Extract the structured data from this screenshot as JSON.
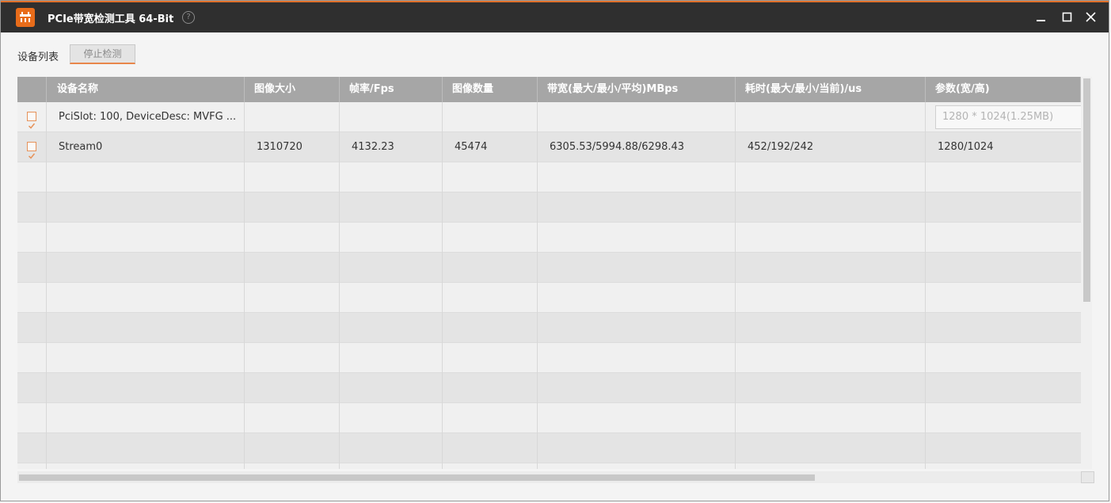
{
  "window": {
    "title": "PCIe带宽检测工具 64-Bit",
    "help_symbol": "?",
    "accent_color": "#e86c1a"
  },
  "toolbar": {
    "device_list_label": "设备列表",
    "stop_button_label": "停止检测"
  },
  "table": {
    "columns": [
      "",
      "设备名称",
      "图像大小",
      "帧率/Fps",
      "图像数量",
      "带宽(最大/最小/平均)MBps",
      "耗时(最大/最小/当前)/us",
      "参数(宽/高)"
    ],
    "rows": [
      {
        "checked": true,
        "device_name": "PciSlot: 100, DeviceDesc: MVFG ...",
        "image_size": "",
        "fps": "",
        "image_count": "",
        "bandwidth": "",
        "latency": "",
        "param": "",
        "param_placeholder": "1280 * 1024(1.25MB)"
      },
      {
        "checked": true,
        "device_name": "Stream0",
        "image_size": "1310720",
        "fps": "4132.23",
        "image_count": "45474",
        "bandwidth": "6305.53/5994.88/6298.43",
        "latency": "452/192/242",
        "param": "1280/1024",
        "param_placeholder": ""
      }
    ]
  }
}
